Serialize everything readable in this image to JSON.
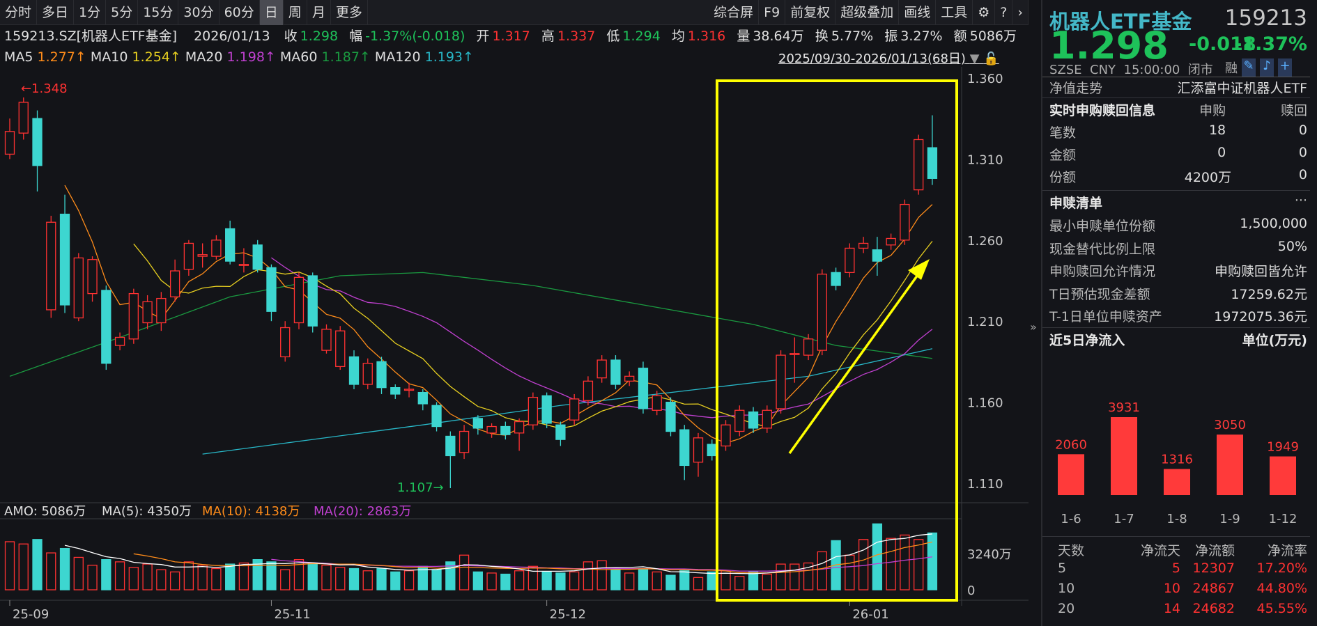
{
  "toolbar": {
    "periods": [
      "分时",
      "多日",
      "1分",
      "5分",
      "15分",
      "30分",
      "60分",
      "日",
      "周",
      "月",
      "更多"
    ],
    "active": "日",
    "tools": [
      "综合屏",
      "F9",
      "前复权",
      "超级叠加",
      "画线",
      "工具"
    ],
    "settings_icon": "gear-icon",
    "help_icon": "question-icon",
    "next_icon": "chevron-right-icon"
  },
  "info": {
    "code": "159213.SZ[机器人ETF基金]",
    "date": "2026/01/13",
    "close_label": "收",
    "close": "1.298",
    "chg_label": "幅",
    "chg": "-1.37%(-0.018)",
    "open_label": "开",
    "open": "1.317",
    "high_label": "高",
    "high": "1.337",
    "low_label": "低",
    "low": "1.294",
    "avg_label": "均",
    "avg": "1.316",
    "vol_label": "量",
    "vol": "38.64万",
    "turn_label": "换",
    "turn": "5.77%",
    "amp_label": "振",
    "amp": "3.27%",
    "amt_label": "额",
    "amt": "5086万"
  },
  "ma": {
    "ma5_label": "MA5",
    "ma5": "1.277↑",
    "ma10_label": "MA10",
    "ma10": "1.254↑",
    "ma20_label": "MA20",
    "ma20": "1.198↑",
    "ma60_label": "MA60",
    "ma60": "1.187↑",
    "ma120_label": "MA120",
    "ma120": "1.193↑"
  },
  "range": "2025/09/30-2026/01/13(68日)",
  "colors": {
    "up": "#ff3232",
    "down": "#3dd6d0",
    "ma5": "#ff8c1a",
    "ma10": "#e8d020",
    "ma20": "#c040d0",
    "ma60": "#1a9a40",
    "ma120": "#28b8c8",
    "highlight": "#ffff00"
  },
  "chart_data": {
    "type": "candlestick",
    "y_ticks": [
      "1.360",
      "1.310",
      "1.260",
      "1.210",
      "1.160",
      "1.110"
    ],
    "x_ticks": [
      {
        "label": "25-09",
        "index": 0
      },
      {
        "label": "25-11",
        "index": 19
      },
      {
        "label": "25-12",
        "index": 39
      },
      {
        "label": "26-01",
        "index": 61
      }
    ],
    "high_label": "←1.348",
    "low_label": "1.107→",
    "ohlc": [
      [
        1.313,
        1.335,
        1.31,
        1.327
      ],
      [
        1.326,
        1.348,
        1.322,
        1.345
      ],
      [
        1.335,
        1.34,
        1.29,
        1.306
      ],
      [
        1.217,
        1.275,
        1.212,
        1.271
      ],
      [
        1.276,
        1.288,
        1.215,
        1.22
      ],
      [
        1.212,
        1.252,
        1.21,
        1.249
      ],
      [
        1.227,
        1.25,
        1.222,
        1.248
      ],
      [
        1.229,
        1.232,
        1.18,
        1.184
      ],
      [
        1.195,
        1.203,
        1.192,
        1.2
      ],
      [
        1.199,
        1.23,
        1.196,
        1.227
      ],
      [
        1.209,
        1.226,
        1.205,
        1.222
      ],
      [
        1.209,
        1.228,
        1.204,
        1.224
      ],
      [
        1.225,
        1.248,
        1.222,
        1.241
      ],
      [
        1.242,
        1.26,
        1.238,
        1.258
      ],
      [
        1.25,
        1.258,
        1.243,
        1.251
      ],
      [
        1.25,
        1.263,
        1.248,
        1.26
      ],
      [
        1.267,
        1.272,
        1.245,
        1.247
      ],
      [
        1.245,
        1.255,
        1.24,
        1.245
      ],
      [
        1.257,
        1.26,
        1.24,
        1.242
      ],
      [
        1.243,
        1.245,
        1.21,
        1.216
      ],
      [
        1.188,
        1.21,
        1.185,
        1.206
      ],
      [
        1.209,
        1.24,
        1.205,
        1.237
      ],
      [
        1.238,
        1.24,
        1.203,
        1.207
      ],
      [
        1.192,
        1.208,
        1.19,
        1.205
      ],
      [
        1.182,
        1.207,
        1.18,
        1.204
      ],
      [
        1.188,
        1.192,
        1.168,
        1.171
      ],
      [
        1.171,
        1.187,
        1.168,
        1.184
      ],
      [
        1.185,
        1.188,
        1.165,
        1.169
      ],
      [
        1.169,
        1.171,
        1.162,
        1.165
      ],
      [
        1.168,
        1.172,
        1.163,
        1.168
      ],
      [
        1.166,
        1.168,
        1.155,
        1.159
      ],
      [
        1.158,
        1.16,
        1.142,
        1.145
      ],
      [
        1.139,
        1.142,
        1.107,
        1.127
      ],
      [
        1.129,
        1.146,
        1.125,
        1.142
      ],
      [
        1.15,
        1.152,
        1.14,
        1.144
      ],
      [
        1.141,
        1.147,
        1.138,
        1.145
      ],
      [
        1.145,
        1.148,
        1.137,
        1.14
      ],
      [
        1.141,
        1.15,
        1.13,
        1.148
      ],
      [
        1.146,
        1.166,
        1.143,
        1.163
      ],
      [
        1.164,
        1.166,
        1.144,
        1.147
      ],
      [
        1.146,
        1.148,
        1.133,
        1.137
      ],
      [
        1.149,
        1.165,
        1.146,
        1.162
      ],
      [
        1.161,
        1.176,
        1.158,
        1.173
      ],
      [
        1.175,
        1.189,
        1.172,
        1.186
      ],
      [
        1.186,
        1.189,
        1.168,
        1.171
      ],
      [
        1.173,
        1.179,
        1.17,
        1.176
      ],
      [
        1.181,
        1.185,
        1.153,
        1.156
      ],
      [
        1.155,
        1.167,
        1.152,
        1.164
      ],
      [
        1.16,
        1.163,
        1.139,
        1.142
      ],
      [
        1.143,
        1.146,
        1.112,
        1.121
      ],
      [
        1.123,
        1.141,
        1.114,
        1.138
      ],
      [
        1.134,
        1.137,
        1.124,
        1.127
      ],
      [
        1.133,
        1.149,
        1.13,
        1.146
      ],
      [
        1.142,
        1.158,
        1.139,
        1.155
      ],
      [
        1.154,
        1.157,
        1.141,
        1.144
      ],
      [
        1.144,
        1.158,
        1.141,
        1.155
      ],
      [
        1.156,
        1.192,
        1.153,
        1.189
      ],
      [
        1.19,
        1.2,
        1.172,
        1.19
      ],
      [
        1.189,
        1.202,
        1.186,
        1.199
      ],
      [
        1.192,
        1.242,
        1.189,
        1.239
      ],
      [
        1.24,
        1.243,
        1.229,
        1.232
      ],
      [
        1.24,
        1.258,
        1.237,
        1.255
      ],
      [
        1.255,
        1.262,
        1.252,
        1.258
      ],
      [
        1.254,
        1.262,
        1.238,
        1.247
      ],
      [
        1.257,
        1.264,
        1.254,
        1.261
      ],
      [
        1.26,
        1.285,
        1.257,
        1.282
      ],
      [
        1.291,
        1.325,
        1.288,
        1.322
      ],
      [
        1.317,
        1.337,
        1.294,
        1.298
      ]
    ],
    "ma60": [
      [
        0,
        1.176
      ],
      [
        8,
        1.2
      ],
      [
        16,
        1.225
      ],
      [
        24,
        1.238
      ],
      [
        30,
        1.24
      ],
      [
        38,
        1.232
      ],
      [
        46,
        1.22
      ],
      [
        54,
        1.208
      ],
      [
        60,
        1.195
      ],
      [
        67,
        1.187
      ]
    ],
    "ma120": [
      [
        14,
        1.128
      ],
      [
        30,
        1.146
      ],
      [
        40,
        1.158
      ],
      [
        50,
        1.168
      ],
      [
        58,
        1.176
      ],
      [
        67,
        1.193
      ]
    ],
    "amo": {
      "label": "AMO: 5086万",
      "ma5_label": "MA(5): 4350万",
      "ma10_label": "MA(10): 4138万",
      "ma20_label": "MA(20): 2863万",
      "tick_mid": "3240万",
      "tick_zero": "0",
      "values": [
        4300,
        4100,
        4500,
        3300,
        3700,
        2900,
        2200,
        2700,
        2500,
        2000,
        2300,
        1800,
        1600,
        2500,
        2200,
        1900,
        2300,
        2400,
        2700,
        2500,
        1800,
        2700,
        2400,
        2200,
        2000,
        1900,
        1700,
        1900,
        1600,
        1700,
        2100,
        1800,
        2500,
        3100,
        1600,
        1500,
        1400,
        1700,
        2100,
        1600,
        1500,
        1600,
        2500,
        2600,
        1800,
        1500,
        1900,
        1600,
        1300,
        1700,
        1100,
        1600,
        1700,
        1200,
        1600,
        1400,
        2300,
        2300,
        2400,
        3400,
        4400,
        3100,
        4500,
        5900,
        4600,
        4900,
        4500,
        5086
      ]
    }
  },
  "right": {
    "name": "机器人ETF基金",
    "code": "159213",
    "price": "1.298",
    "chg": "-0.018",
    "pct": "-1.37%",
    "exchange": "SZSE",
    "currency": "CNY",
    "time": "15:00:00",
    "status": "闭市",
    "margin": "融",
    "nav_label": "净值走势",
    "nav_value": "汇添富中证机器人ETF",
    "rt": {
      "title": "实时申购赎回信息",
      "col1": "申购",
      "col2": "赎回",
      "rows": [
        {
          "label": "笔数",
          "a": "18",
          "b": "0"
        },
        {
          "label": "金额",
          "a": "0",
          "b": "0"
        },
        {
          "label": "份额",
          "a": "4200万",
          "b": "0"
        }
      ]
    },
    "list": {
      "title": "申赎清单",
      "more": "···",
      "rows": [
        {
          "label": "最小申赎单位份额",
          "value": "1,500,000"
        },
        {
          "label": "现金替代比例上限",
          "value": "50%"
        },
        {
          "label": "申购赎回允许情况",
          "value": "申购赎回皆允许"
        },
        {
          "label": "T日预估现金差额",
          "value": "17259.62元"
        },
        {
          "label": "T-1日单位申赎资产",
          "value": "1972075.36元"
        }
      ]
    },
    "flow": {
      "title": "近5日净流入",
      "unit": "单位(万元)",
      "categories": [
        "1-6",
        "1-7",
        "1-8",
        "1-9",
        "1-12"
      ],
      "values": [
        2060,
        3931,
        1316,
        3050,
        1949
      ]
    },
    "table": {
      "headers": [
        "天数",
        "净流天",
        "净流额",
        "净流率"
      ],
      "rows": [
        [
          "5",
          "5",
          "12307",
          "17.20%"
        ],
        [
          "10",
          "10",
          "24867",
          "44.80%"
        ],
        [
          "20",
          "14",
          "24682",
          "45.55%"
        ]
      ]
    }
  }
}
